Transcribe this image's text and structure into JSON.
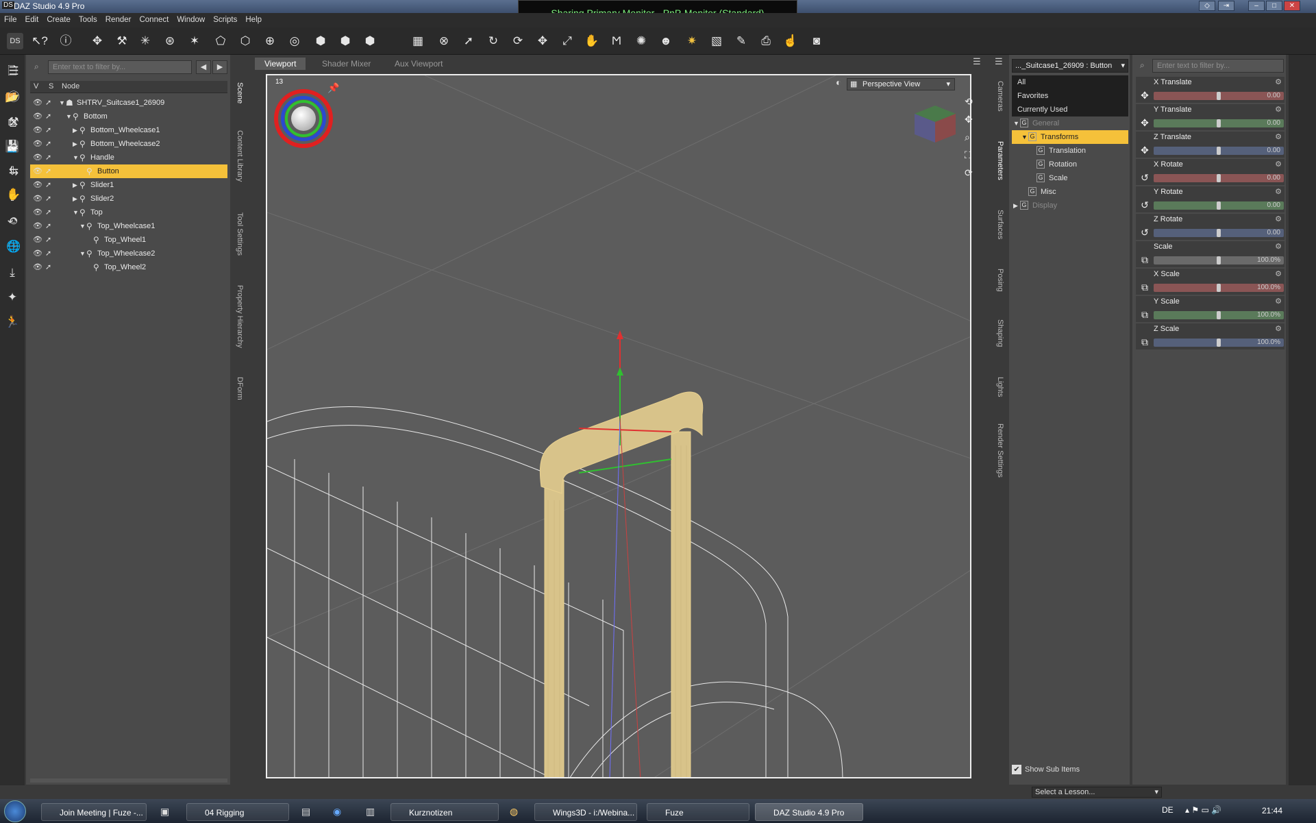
{
  "window": {
    "title": "DAZ Studio 4.9 Pro",
    "sharing_banner": "Sharing Primary Monitor - PnP-Monitor (Standard)"
  },
  "menu": [
    "File",
    "Edit",
    "Create",
    "Tools",
    "Render",
    "Connect",
    "Window",
    "Scripts",
    "Help"
  ],
  "scene": {
    "filter_placeholder": "Enter text to filter by...",
    "columns": {
      "v": "V",
      "s": "S",
      "node": "Node"
    },
    "nodes": [
      {
        "label": "SHTRV_Suitcase1_26909",
        "depth": 0,
        "expander": "▼",
        "icon": "figure-icon"
      },
      {
        "label": "Bottom",
        "depth": 1,
        "expander": "▼",
        "icon": "bone-icon"
      },
      {
        "label": "Bottom_Wheelcase1",
        "depth": 2,
        "expander": "▶",
        "icon": "bone-icon"
      },
      {
        "label": "Bottom_Wheelcase2",
        "depth": 2,
        "expander": "▶",
        "icon": "bone-icon"
      },
      {
        "label": "Handle",
        "depth": 2,
        "expander": "▼",
        "icon": "bone-icon"
      },
      {
        "label": "Button",
        "depth": 3,
        "expander": "",
        "icon": "bone-icon",
        "selected": true
      },
      {
        "label": "Slider1",
        "depth": 2,
        "expander": "▶",
        "icon": "bone-icon"
      },
      {
        "label": "Slider2",
        "depth": 2,
        "expander": "▶",
        "icon": "bone-icon"
      },
      {
        "label": "Top",
        "depth": 2,
        "expander": "▼",
        "icon": "bone-icon"
      },
      {
        "label": "Top_Wheelcase1",
        "depth": 3,
        "expander": "▼",
        "icon": "bone-icon"
      },
      {
        "label": "Top_Wheel1",
        "depth": 4,
        "expander": "",
        "icon": "bone-icon"
      },
      {
        "label": "Top_Wheelcase2",
        "depth": 3,
        "expander": "▼",
        "icon": "bone-icon"
      },
      {
        "label": "Top_Wheel2",
        "depth": 4,
        "expander": "",
        "icon": "bone-icon"
      }
    ]
  },
  "left_tabs": [
    "Scene",
    "Content Library",
    "Tool Settings",
    "Property Hierarchy",
    "DForm"
  ],
  "viewport_tabs": [
    "Viewport",
    "Shader Mixer",
    "Aux Viewport"
  ],
  "viewport": {
    "camera": "Perspective View",
    "fps": "13"
  },
  "right_tabs": [
    "Cameras",
    "Parameters",
    "Surfaces",
    "Posing",
    "Shaping",
    "Lights",
    "Render Settings"
  ],
  "params": {
    "node_selector": "..._Suitcase1_26909 : Button",
    "groups": [
      {
        "label": "All",
        "depth": 0,
        "style": "dark"
      },
      {
        "label": "Favorites",
        "depth": 0,
        "style": "dark"
      },
      {
        "label": "Currently Used",
        "depth": 0,
        "style": "dark"
      },
      {
        "label": "General",
        "depth": 0,
        "style": "tree",
        "expander": "▼"
      },
      {
        "label": "Transforms",
        "depth": 1,
        "style": "sel",
        "expander": "▼"
      },
      {
        "label": "Translation",
        "depth": 2,
        "style": "tree"
      },
      {
        "label": "Rotation",
        "depth": 2,
        "style": "tree"
      },
      {
        "label": "Scale",
        "depth": 2,
        "style": "tree"
      },
      {
        "label": "Misc",
        "depth": 1,
        "style": "tree"
      },
      {
        "label": "Display",
        "depth": 0,
        "style": "tree",
        "expander": "▶"
      }
    ],
    "show_sub_items": "Show Sub Items"
  },
  "properties_filter": "Enter text to filter by...",
  "properties": [
    {
      "name": "X Translate",
      "value": "0.00",
      "color": "#8a5555",
      "icon": "move-icon",
      "level": 0.5
    },
    {
      "name": "Y Translate",
      "value": "0.00",
      "color": "#5a7a5a",
      "icon": "move-icon",
      "level": 0.5
    },
    {
      "name": "Z Translate",
      "value": "0.00",
      "color": "#55607a",
      "icon": "move-icon",
      "level": 0.5
    },
    {
      "name": "X Rotate",
      "value": "0.00",
      "color": "#8a5555",
      "icon": "rotate-icon",
      "level": 0.5
    },
    {
      "name": "Y Rotate",
      "value": "0.00",
      "color": "#5a7a5a",
      "icon": "rotate-icon",
      "level": 0.5
    },
    {
      "name": "Z Rotate",
      "value": "0.00",
      "color": "#55607a",
      "icon": "rotate-icon",
      "level": 0.5
    },
    {
      "name": "Scale",
      "value": "100.0%",
      "color": "#6a6a6a",
      "icon": "scale-icon",
      "level": 0.5
    },
    {
      "name": "X Scale",
      "value": "100.0%",
      "color": "#8a5555",
      "icon": "scale-icon",
      "level": 0.5
    },
    {
      "name": "Y Scale",
      "value": "100.0%",
      "color": "#5a7a5a",
      "icon": "scale-icon",
      "level": 0.5
    },
    {
      "name": "Z Scale",
      "value": "100.0%",
      "color": "#55607a",
      "icon": "scale-icon",
      "level": 0.5
    }
  ],
  "lesson": "Select a Lesson...",
  "taskbar": {
    "items": [
      "Join Meeting | Fuze -...",
      "04 Rigging",
      "Kurznotizen",
      "Wings3D - i:/Webina...",
      "Fuze",
      "DAZ Studio 4.9 Pro"
    ],
    "lang": "DE",
    "time": "21:44"
  }
}
